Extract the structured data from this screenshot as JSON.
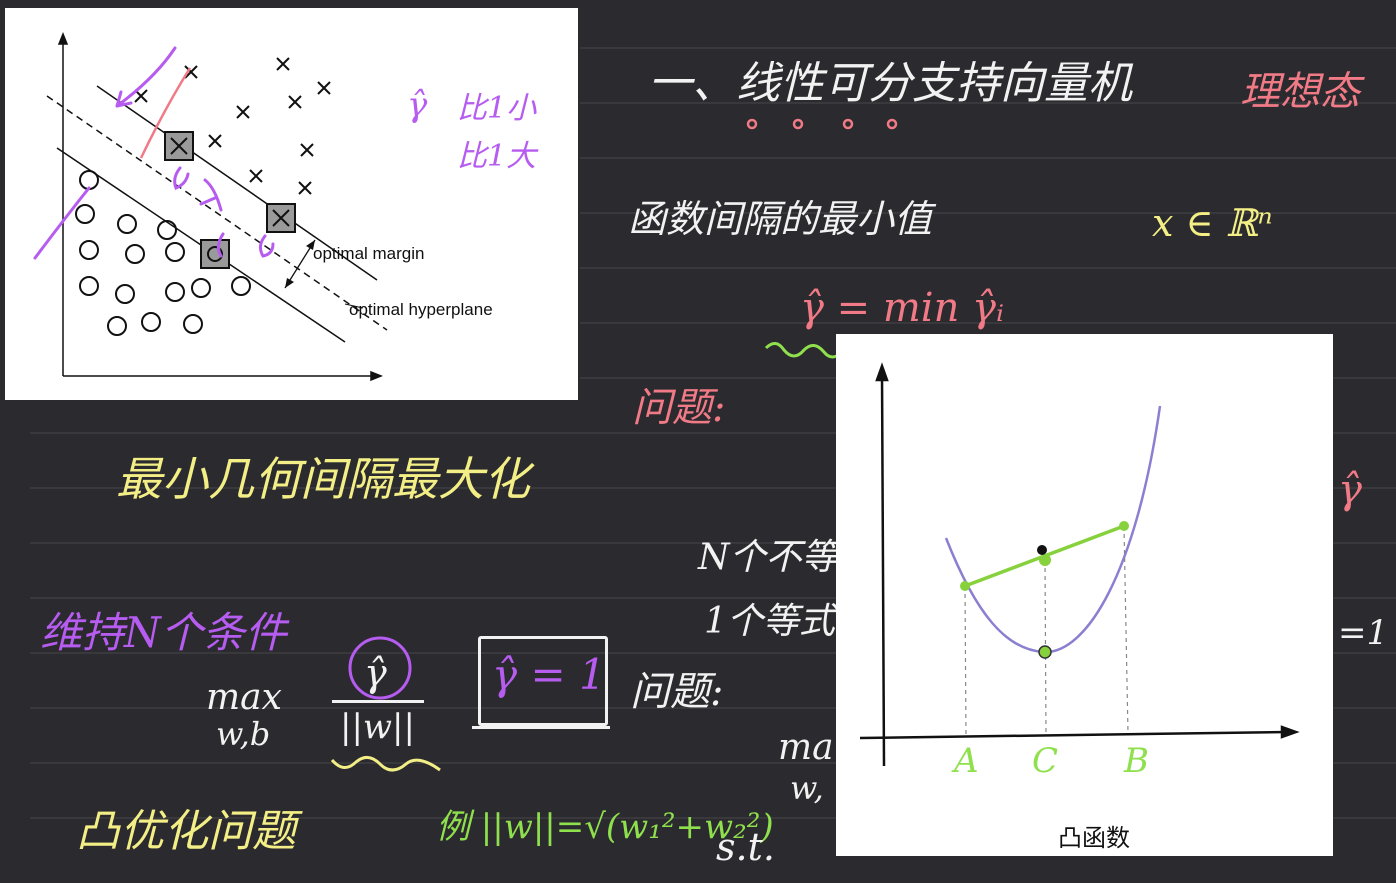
{
  "svm_figure": {
    "margin_label": "optimal margin",
    "hyperplane_label": "optimal hyperplane",
    "gamma_annot": "γ̂",
    "annot_smaller": "比1小",
    "annot_larger": "比1大"
  },
  "notes": {
    "title": "一、线性可分支持向量机",
    "title_tag": "理想态",
    "functional_margin_min": "函数间隔的最小值",
    "domain": "x ∈ ℝⁿ",
    "gamma_min": "γ̂ = min γ̂ᵢ",
    "problem_label": "问题:",
    "geo_margin_max": "最小几何间隔最大化",
    "n_inequality": "N个不等",
    "one_equality": "1个等式",
    "keep_n_conditions": "维持N个条件",
    "max_label": "max",
    "wb_label": "w,b",
    "gamma_hat": "γ̂",
    "norm_w": "||w||",
    "gamma_eq_one": "γ̂ = 1",
    "problem_label2": "问题:",
    "convex_opt": "凸优化问题",
    "example": "例 ||w||=√(w₁²+w₂²)",
    "st_label": "s.t.",
    "cut_max": "ma",
    "cut_w": "w,",
    "cut_gamma": "γ̂",
    "cut_eq1": "=1"
  },
  "convex_figure": {
    "point_a": "A",
    "point_c": "C",
    "point_b": "B",
    "caption": "凸函数"
  },
  "colors": {
    "board": "#2b2a2e",
    "pink": "#f07a86",
    "yellow": "#f3ef86",
    "purple": "#b65cf0",
    "green": "#8fe04d",
    "curve": "#8a7fd0"
  }
}
